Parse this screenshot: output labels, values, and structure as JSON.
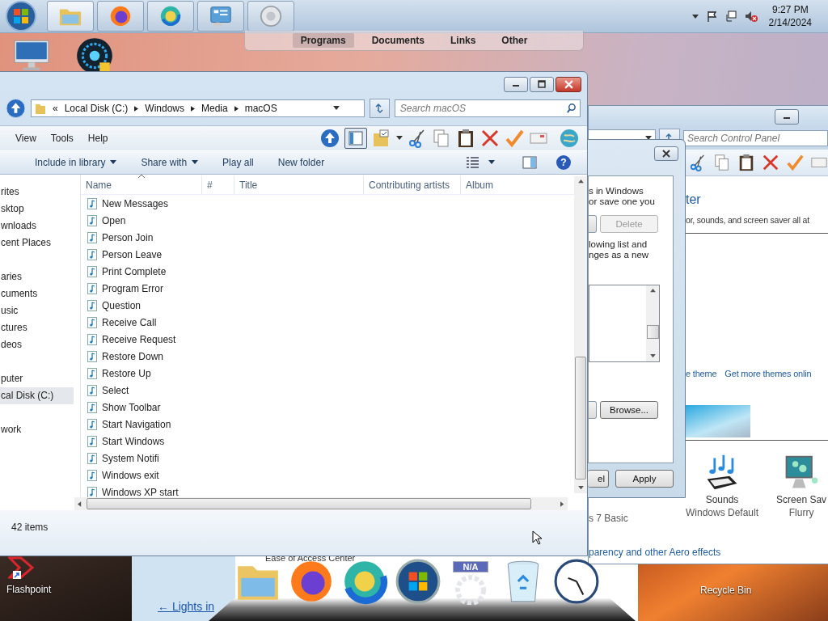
{
  "taskbar": {
    "time": "9:27 PM",
    "date": "2/14/2024"
  },
  "launcher": {
    "tabs": [
      {
        "label": "Programs",
        "selected": true
      },
      {
        "label": "Documents",
        "selected": false
      },
      {
        "label": "Links",
        "selected": false
      },
      {
        "label": "Other",
        "selected": false
      }
    ]
  },
  "desktop": {
    "flashpoint_label": "Flashpoint",
    "recycle_bin_label": "Recycle Bin"
  },
  "explorer": {
    "overflow": "«",
    "breadcrumb": [
      "Local Disk (C:)",
      "Windows",
      "Media",
      "macOS"
    ],
    "search_placeholder": "Search macOS",
    "menu": [
      "View",
      "Tools",
      "Help"
    ],
    "commands": [
      {
        "label": "Include in library",
        "dropdown": true
      },
      {
        "label": "Share with",
        "dropdown": true
      },
      {
        "label": "Play all",
        "dropdown": false
      },
      {
        "label": "New folder",
        "dropdown": false
      }
    ],
    "nav": [
      {
        "label": "rites",
        "selected": false,
        "children": [
          {
            "label": "sktop",
            "selected": false
          },
          {
            "label": "wnloads",
            "selected": false
          },
          {
            "label": "cent Places",
            "selected": false
          }
        ]
      },
      {
        "label": "aries",
        "selected": false,
        "children": [
          {
            "label": "cuments",
            "selected": false
          },
          {
            "label": "usic",
            "selected": false
          },
          {
            "label": "ctures",
            "selected": false
          },
          {
            "label": "deos",
            "selected": false
          }
        ]
      },
      {
        "label": "puter",
        "selected": false,
        "children": [
          {
            "label": "cal Disk (C:)",
            "selected": true
          }
        ]
      },
      {
        "label": "work",
        "selected": false
      }
    ],
    "columns": [
      {
        "label": "Name",
        "sorted": true
      },
      {
        "label": "#",
        "sorted": false
      },
      {
        "label": "Title",
        "sorted": false
      },
      {
        "label": "Contributing artists",
        "sorted": false
      },
      {
        "label": "Album",
        "sorted": false
      }
    ],
    "files": [
      "New Messages",
      "Open",
      "Person Join",
      "Person Leave",
      "Print Complete",
      "Program Error",
      "Question",
      "Receive Call",
      "Receive Request",
      "Restore Down",
      "Restore Up",
      "Select",
      "Show Toolbar",
      "Start Navigation",
      "Start Windows",
      "System Notifi",
      "Windows exit",
      "Windows XP start"
    ],
    "help_icon": "?",
    "status": "42 items"
  },
  "control_panel": {
    "search_placeholder": "Search Control Panel",
    "heading": "ter",
    "description": "or, sounds, and screen saver all at",
    "links": [
      "e theme",
      "Get more themes onlin"
    ],
    "theme_label": "s 7 Basic",
    "settings": [
      {
        "kind": "sounds",
        "title": "Sounds",
        "value": "Windows Default"
      },
      {
        "kind": "screensaver",
        "title": "Screen Sav",
        "value": "Flurry"
      }
    ],
    "aero_link": "parency and other Aero effects"
  },
  "dialog": {
    "intro": [
      "s in Windows",
      "or save one you"
    ],
    "delete_button": {
      "label": "Delete",
      "disabled": true
    },
    "hint": [
      "lowing list and",
      "nges as a new"
    ],
    "browse_button": "Browse...",
    "cancel_button": "el",
    "apply_button": "Apply"
  },
  "ease_window": {
    "title": "Ease of Access Center",
    "link": "← Lights in"
  },
  "dock": {
    "badge": "N/A"
  }
}
